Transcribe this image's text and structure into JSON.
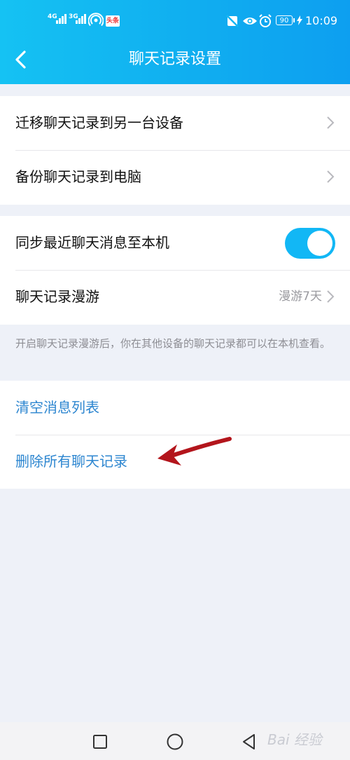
{
  "status_bar": {
    "sim1": "4G",
    "sim2": "3G",
    "news_badge": "头条",
    "battery": "90",
    "time": "10:09"
  },
  "header": {
    "title": "聊天记录设置",
    "back_icon": "chevron-left-icon"
  },
  "group1": {
    "items": [
      {
        "label": "迁移聊天记录到另一台设备"
      },
      {
        "label": "备份聊天记录到电脑"
      }
    ]
  },
  "group2": {
    "sync_label": "同步最近聊天消息至本机",
    "sync_enabled": true,
    "roaming_label": "聊天记录漫游",
    "roaming_value": "漫游7天"
  },
  "note": "开启聊天记录漫游后，你在其他设备的聊天记录都可以在本机查看。",
  "group3": {
    "clear_label": "清空消息列表",
    "delete_label": "删除所有聊天记录"
  },
  "annotation": {
    "arrow_color": "#b3151c"
  },
  "nav_bar": {
    "buttons": [
      "square-icon",
      "circle-icon",
      "triangle-back-icon"
    ]
  },
  "watermark": "Bai 经验",
  "colors": {
    "header_gradient_start": "#15c2f3",
    "header_gradient_end": "#0d9ff0",
    "accent_blue": "#2d86d0",
    "toggle_on": "#12b7f5",
    "background": "#eef1f8"
  }
}
